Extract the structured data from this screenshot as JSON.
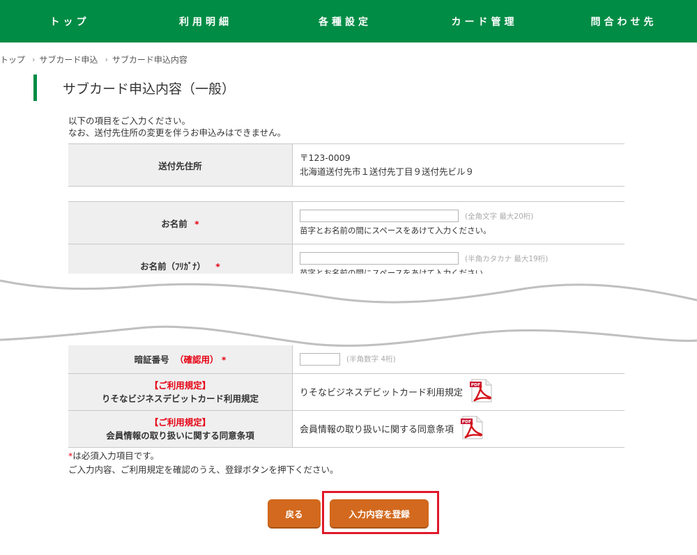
{
  "nav": {
    "items": [
      {
        "label": "トップ"
      },
      {
        "label": "利用明細"
      },
      {
        "label": "各種設定"
      },
      {
        "label": "カード管理"
      },
      {
        "label": "問合わせ先"
      }
    ]
  },
  "breadcrumb": {
    "items": [
      "トップ",
      "サブカード申込",
      "サブカード申込内容"
    ],
    "separator": "›"
  },
  "page": {
    "title": "サブカード申込内容（一般）",
    "intro_line1": "以下の項目をご入力ください。",
    "intro_line2": "なお、送付先住所の変更を伴うお申込みはできません。"
  },
  "address": {
    "label": "送付先住所",
    "postal": "〒123-0009",
    "line": "北海道送付先市１送付先丁目９送付先ビル９"
  },
  "fields": {
    "name": {
      "label": "お名前",
      "required_mark": "*",
      "value": "",
      "hint": "(全角文字 最大20桁)",
      "note": "苗字とお名前の間にスペースをあけて入力ください。"
    },
    "name_kana": {
      "label": "お名前（ﾌﾘｶﾞﾅ）",
      "required_mark": "*",
      "value": "",
      "hint": "(半角カタカナ 最大19桁)",
      "note": "苗字とお名前の間にスペースをあけて入力ください。"
    },
    "pin_confirm": {
      "label": "暗証番号",
      "label_suffix": "（確認用）",
      "required_mark": "*",
      "value": "",
      "hint": "(半角数字 4桁)"
    }
  },
  "terms": [
    {
      "tag": "【ご利用規定】",
      "title": "りそなビジネスデビットカード利用規定",
      "link": "りそなビジネスデビットカード利用規定",
      "icon": "pdf-icon"
    },
    {
      "tag": "【ご利用規定】",
      "title": "会員情報の取り扱いに関する同意条項",
      "link": "会員情報の取り扱いに関する同意条項",
      "icon": "pdf-icon"
    }
  ],
  "footer": {
    "required_mark": "*",
    "required_note": "は必須入力項目です。",
    "confirm_note": "ご入力内容、ご利用規定を確認のうえ、登録ボタンを押下ください。"
  },
  "buttons": {
    "back": "戻る",
    "submit": "入力内容を登録"
  },
  "colors": {
    "brand_green": "#008c45",
    "button_orange": "#d2691e",
    "required_red": "#e60012",
    "highlight_red": "#e0192b"
  }
}
